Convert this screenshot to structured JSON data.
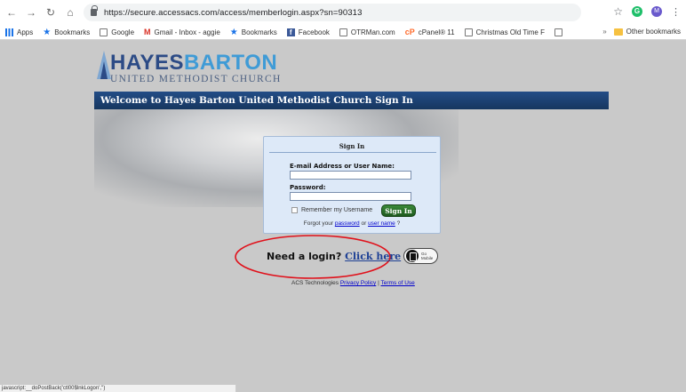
{
  "browser": {
    "url": "https://secure.accessacs.com/access/memberlogin.aspx?sn=90313",
    "avatar_initial": "M",
    "extension_initial": "G"
  },
  "bookmarks": {
    "items": [
      {
        "label": "Apps",
        "icon": "apps-icon"
      },
      {
        "label": "Bookmarks",
        "icon": "star-icon"
      },
      {
        "label": "Google",
        "icon": "page-icon"
      },
      {
        "label": "Gmail - Inbox - aggie",
        "icon": "gmail-icon"
      },
      {
        "label": "Bookmarks",
        "icon": "star-icon"
      },
      {
        "label": "Facebook",
        "icon": "facebook-icon"
      },
      {
        "label": "OTRMan.com",
        "icon": "page-icon"
      },
      {
        "label": "cPanel® 11",
        "icon": "cpanel-icon"
      },
      {
        "label": "Christmas Old Time F",
        "icon": "page-icon"
      },
      {
        "label": "",
        "icon": "page-icon"
      }
    ],
    "overflow": "»",
    "other": "Other bookmarks"
  },
  "logo": {
    "hayes": "HAYES",
    "barton": "BARTON",
    "subtitle": "UNITED METHODIST CHURCH"
  },
  "banner": {
    "title": "Welcome to Hayes Barton United Methodist Church Sign In"
  },
  "signin": {
    "title": "Sign In",
    "email_label": "E-mail Address or User Name:",
    "email_value": "",
    "password_label": "Password:",
    "password_value": "",
    "remember_label": "Remember my Username",
    "button": "Sign In",
    "forgot_prefix": "Forgot your",
    "forgot_password": "password",
    "forgot_or": "or",
    "forgot_username": "user name",
    "forgot_suffix": "?"
  },
  "register": {
    "prompt": "Need a login?",
    "link": "Click here",
    "highlight_color": "#e0101a"
  },
  "mobile": {
    "line1": "Go",
    "line2": "Mobile"
  },
  "footer": {
    "company": "ACS Technologies",
    "privacy": "Privacy Policy",
    "separator": "|",
    "terms": "Terms of Use"
  },
  "statusbar": {
    "text": "javascript:__doPostBack('ctl00$lnkLogon','')"
  }
}
